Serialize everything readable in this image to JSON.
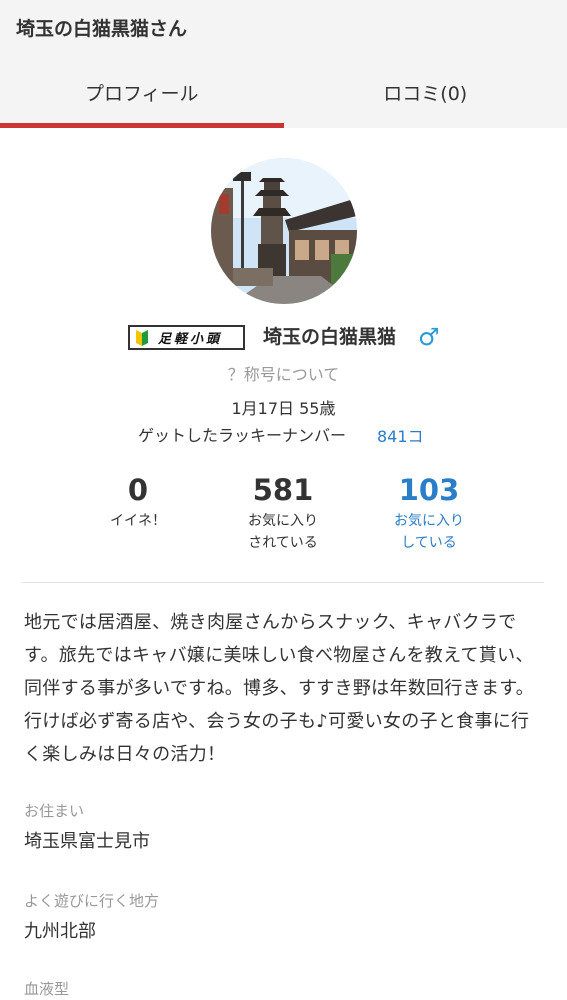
{
  "header": {
    "title": "埼玉の白猫黒猫さん"
  },
  "tabs": [
    {
      "label": "プロフィール",
      "active": true
    },
    {
      "label": "ロコミ(0)",
      "active": false
    }
  ],
  "colors": {
    "accent": "#cc3333",
    "link": "#2a7dc9",
    "male": "#2a9ad6"
  },
  "profile": {
    "badge_text": "足軽小頭",
    "name": "埼玉の白猫黒猫",
    "gender_icon": "♂",
    "title_link": "？称号について",
    "birthday_age": "1月17日 55歳",
    "lucky_label": "ゲットしたラッキーナンバー",
    "lucky_value": "841コ"
  },
  "stats": [
    {
      "number": "0",
      "label1": "イイネ！",
      "label2": ""
    },
    {
      "number": "581",
      "label1": "お気に入り",
      "label2": "されている"
    },
    {
      "number": "103",
      "label1": "お気に入り",
      "label2": "している"
    }
  ],
  "bio": "地元では居酒屋、焼き肉屋さんからスナック、キャバクラです。旅先ではキャバ嬢に美味しい食べ物屋さんを教えて貰い、同伴する事が多いですね。博多、すすき野は年数回行きます。行けば必ず寄る店や、会う女の子も♪可愛い女の子と食事に行く楽しみは日々の活力！",
  "fields": [
    {
      "label": "お住まい",
      "value": "埼玉県富士見市"
    },
    {
      "label": "よく遊びに行く地方",
      "value": "九州北部"
    },
    {
      "label": "血液型",
      "value": ""
    }
  ]
}
